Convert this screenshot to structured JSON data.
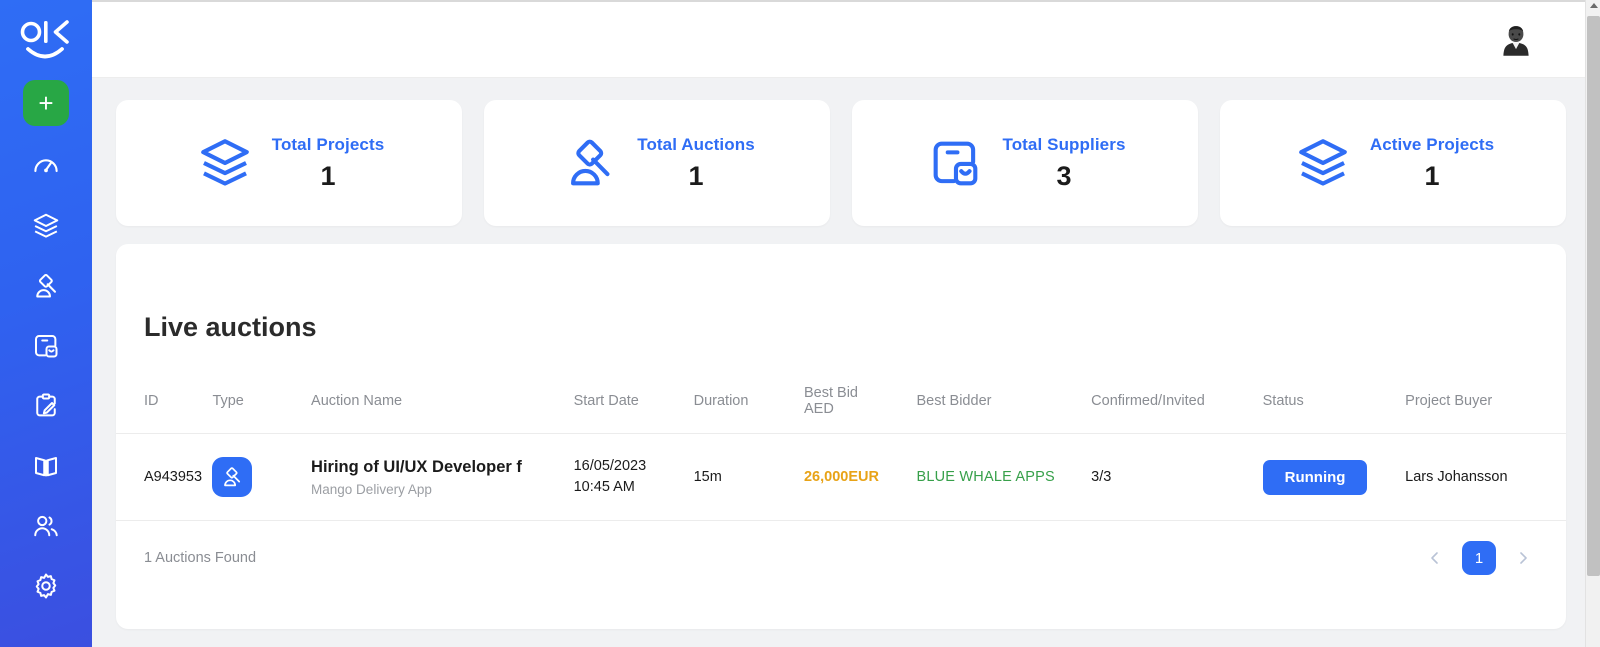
{
  "sidebar": {
    "logo_alt": "olk-logo",
    "add_button_label": "+",
    "items": [
      {
        "name": "dashboard",
        "icon": "speedometer-icon"
      },
      {
        "name": "projects",
        "icon": "layers-icon"
      },
      {
        "name": "auctions",
        "icon": "gavel-icon"
      },
      {
        "name": "suppliers",
        "icon": "supplier-box-icon"
      },
      {
        "name": "requests",
        "icon": "clipboard-edit-icon"
      },
      {
        "name": "catalog",
        "icon": "open-book-icon"
      },
      {
        "name": "users",
        "icon": "users-icon"
      },
      {
        "name": "settings",
        "icon": "gear-icon"
      }
    ]
  },
  "topbar": {
    "avatar_alt": "user-avatar"
  },
  "stats": [
    {
      "label": "Total Projects",
      "value": "1",
      "icon": "layers-icon"
    },
    {
      "label": "Total Auctions",
      "value": "1",
      "icon": "gavel-icon"
    },
    {
      "label": "Total Suppliers",
      "value": "3",
      "icon": "supplier-box-icon"
    },
    {
      "label": "Active Projects",
      "value": "1",
      "icon": "layers-icon"
    }
  ],
  "panel": {
    "title": "Live auctions",
    "columns": [
      "ID",
      "Type",
      "Auction Name",
      "Start Date",
      "Duration",
      "Best Bid AED",
      "Best Bidder",
      "Confirmed/Invited",
      "Status",
      "Project Buyer"
    ],
    "columns_bestbid_line1": "Best Bid",
    "columns_bestbid_line2": "AED",
    "rows": [
      {
        "id": "A943953",
        "type_icon": "gavel-icon",
        "name": "Hiring of UI/UX Developer f",
        "subtitle": "Mango Delivery App",
        "start_date_line1": "16/05/2023",
        "start_date_line2": "10:45 AM",
        "duration": "15m",
        "best_bid": "26,000EUR",
        "best_bidder": "BLUE WHALE APPS",
        "confirmed_invited": "3/3",
        "status": "Running",
        "project_buyer": "Lars Johansson"
      }
    ],
    "footer": {
      "found_text": "1 Auctions Found",
      "prev_label": "‹",
      "current_page": "1",
      "next_label": "›"
    }
  },
  "colors": {
    "brand_blue": "#2f6df5",
    "green_add": "#28a745",
    "bid_orange": "#e8a317",
    "bidder_green": "#37a04a",
    "page_bg": "#f1f2f4"
  }
}
